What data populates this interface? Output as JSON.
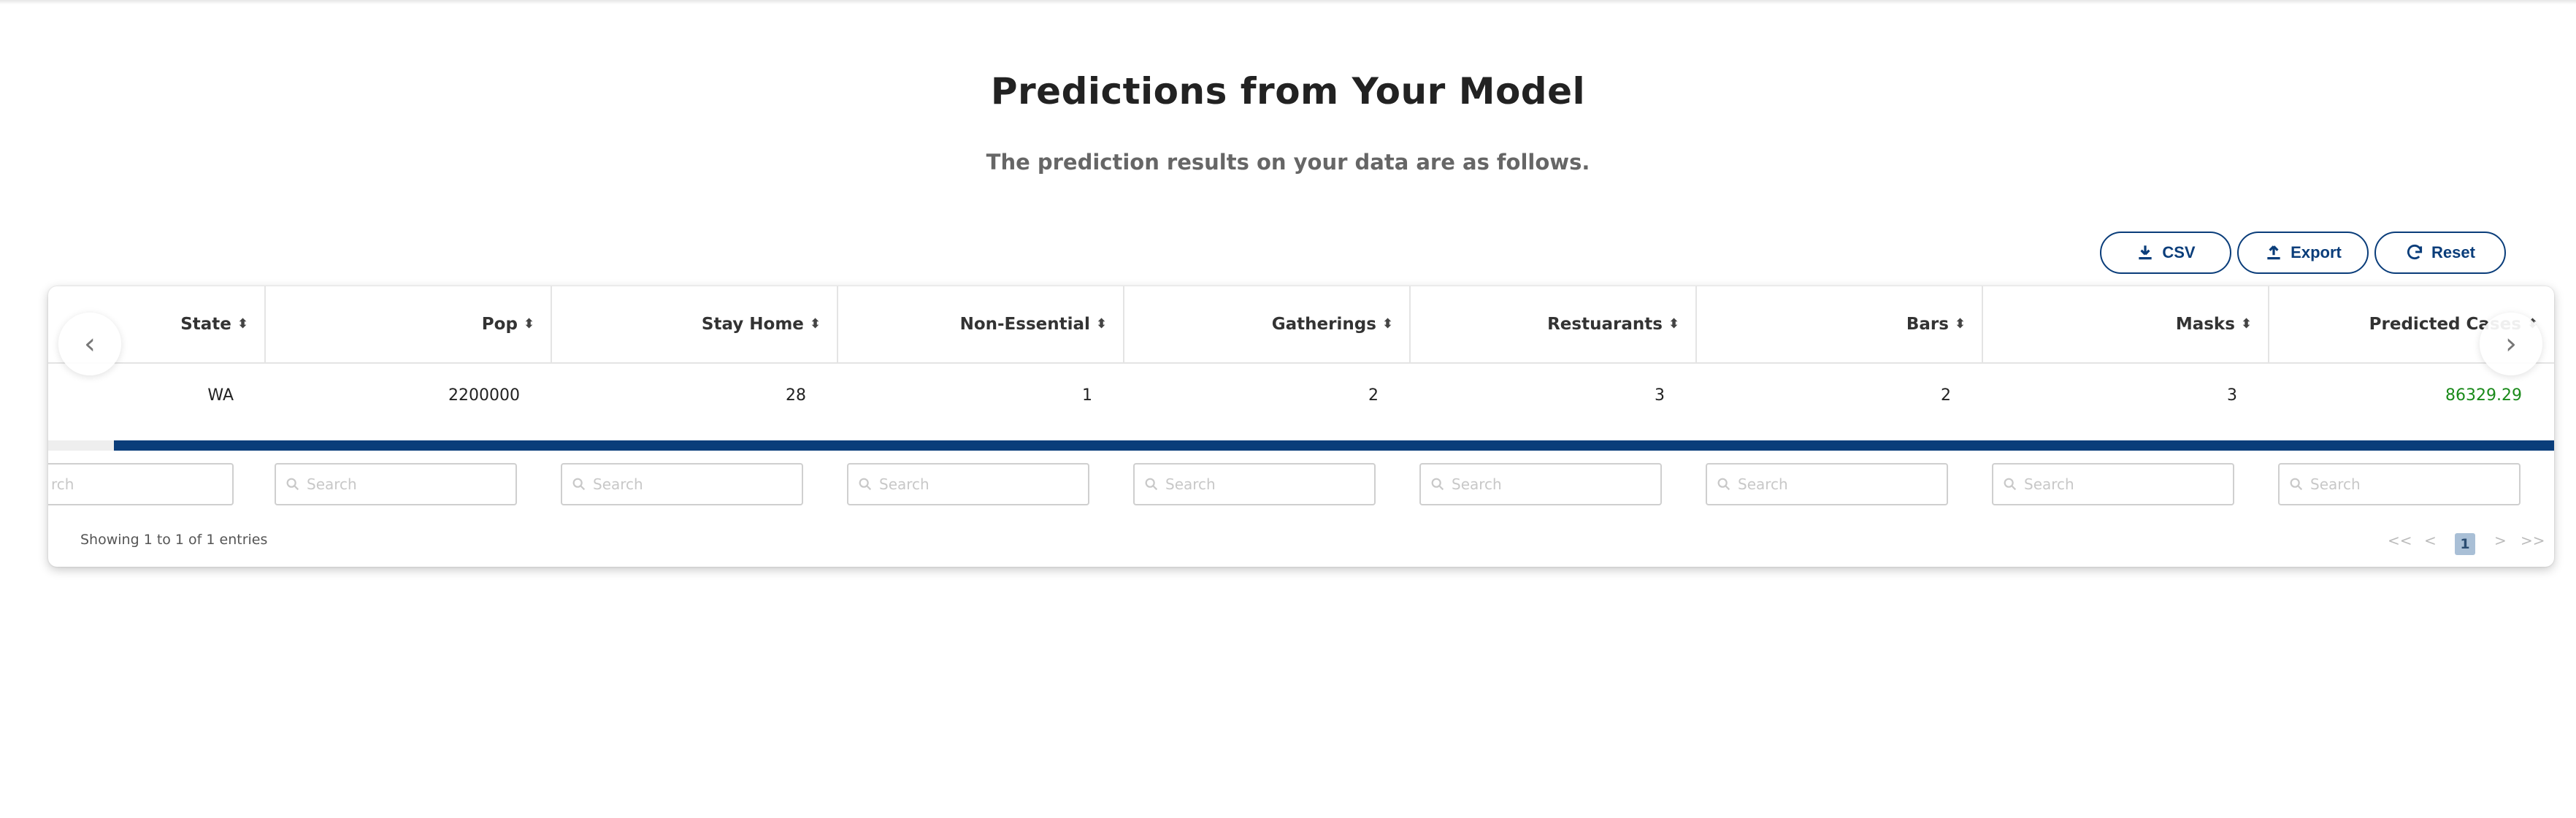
{
  "header": {
    "title": "Predictions from Your Model",
    "subtitle": "The prediction results on your data are as follows."
  },
  "actions": {
    "csv_label": "CSV",
    "export_label": "Export",
    "reset_label": "Reset"
  },
  "table": {
    "columns": [
      "State",
      "Pop",
      "Stay Home",
      "Non-Essential",
      "Gatherings",
      "Restuarants",
      "Bars",
      "Masks",
      "Predicted Cases"
    ],
    "rows": [
      [
        "WA",
        "2200000",
        "28",
        "1",
        "2",
        "3",
        "2",
        "3",
        "86329.29"
      ]
    ],
    "search_placeholder": "Search",
    "first_search_visible": "rch",
    "info": "Showing 1 to 1 of 1 entries",
    "pager": {
      "first": "<<",
      "prev": "<",
      "current": "1",
      "next": ">",
      "last": ">>"
    },
    "horizontal_scroll_fraction": 0.97
  },
  "colors": {
    "accent": "#0a3d7a",
    "prediction_text": "#1a8a1a",
    "active_page_bg": "#a9bfd6"
  },
  "icons": {
    "csv": "download-icon",
    "export": "upload-icon",
    "reset": "refresh-icon",
    "sort": "sort-icon",
    "search": "search-icon",
    "left": "chevron-left-icon",
    "right": "chevron-right-icon"
  }
}
